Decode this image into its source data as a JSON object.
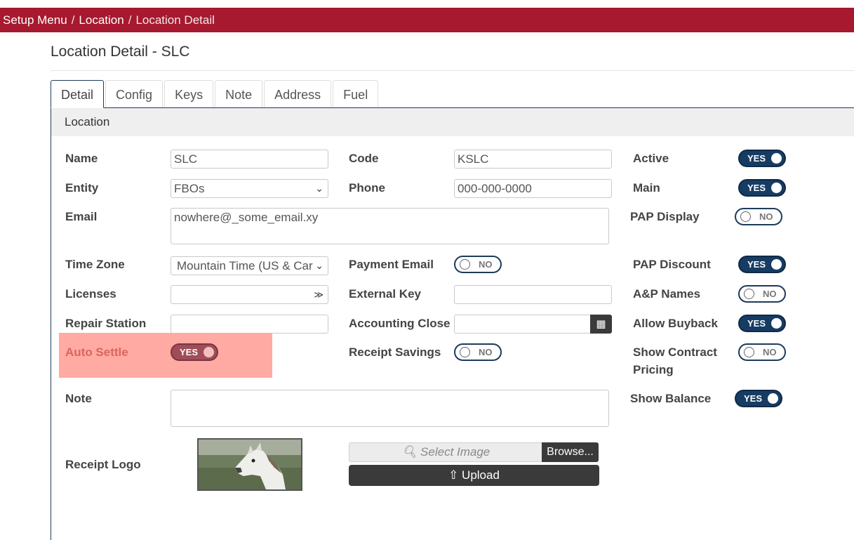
{
  "breadcrumb": {
    "items": [
      "Setup Menu",
      "Location",
      "Location Detail"
    ]
  },
  "page": {
    "title": "Location Detail - SLC"
  },
  "tabs": [
    "Detail",
    "Config",
    "Keys",
    "Note",
    "Address",
    "Fuel"
  ],
  "section": {
    "title": "Location"
  },
  "fields": {
    "name": {
      "label": "Name",
      "value": "SLC"
    },
    "code": {
      "label": "Code",
      "value": "KSLC"
    },
    "entity": {
      "label": "Entity",
      "value": "FBOs"
    },
    "phone": {
      "label": "Phone",
      "value": "000-000-0000"
    },
    "email": {
      "label": "Email",
      "value": "nowhere@_some_email.xy"
    },
    "time_zone": {
      "label": "Time Zone",
      "value": "Mountain Time (US & Car"
    },
    "licenses": {
      "label": "Licenses",
      "value": ""
    },
    "repair_station": {
      "label": "Repair Station",
      "value": ""
    },
    "external_key": {
      "label": "External Key",
      "value": ""
    },
    "accounting_close": {
      "label": "Accounting Close",
      "value": ""
    },
    "note": {
      "label": "Note",
      "value": ""
    },
    "receipt_logo": {
      "label": "Receipt Logo"
    }
  },
  "toggles": {
    "active": {
      "label": "Active",
      "state": "YES"
    },
    "main": {
      "label": "Main",
      "state": "YES"
    },
    "pap_display": {
      "label": "PAP Display",
      "state": "NO"
    },
    "payment_email": {
      "label": "Payment Email",
      "state": "NO"
    },
    "pap_discount": {
      "label": "PAP Discount",
      "state": "YES"
    },
    "ap_names": {
      "label": "A&P Names",
      "state": "NO"
    },
    "allow_buyback": {
      "label": "Allow Buyback",
      "state": "YES"
    },
    "auto_settle": {
      "label": "Auto Settle",
      "state": "YES"
    },
    "receipt_savings": {
      "label": "Receipt Savings",
      "state": "NO"
    },
    "show_contract_pricing": {
      "label_line1": "Show Contract",
      "label_line2": "Pricing",
      "state": "NO"
    },
    "show_balance": {
      "label": "Show Balance",
      "state": "YES"
    }
  },
  "upload": {
    "select_placeholder": "Select Image",
    "browse_label": "Browse...",
    "upload_label": "Upload"
  },
  "colors": {
    "brand_red": "#a6192e",
    "toggle_on": "#163c63",
    "highlight": "#ffaaa2"
  }
}
